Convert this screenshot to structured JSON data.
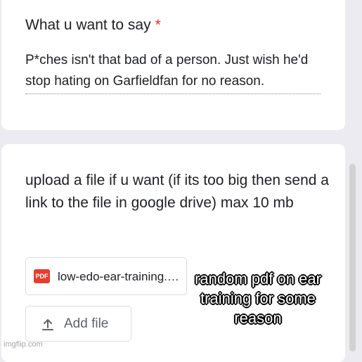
{
  "question_1": {
    "title": "What u want to say",
    "required_mark": "*",
    "answer": "P*ches isn't that bad of a person. Just wish he'd stop hating on Garfieldfan for no reason."
  },
  "question_2": {
    "title": "upload a file if u want (if its too big then send a link to the file in google drive) max 10 mb",
    "file": {
      "type_label": "PDF",
      "name": "low-edo-ear-training.pdf",
      "icon": "pdf-icon"
    },
    "add_file_label": "Add file",
    "add_file_icon": "upload-icon"
  },
  "watermark": "imgflip.com",
  "meme_caption": "random pdf on ear training for some reason",
  "colors": {
    "required": "#d93025",
    "pdf_icon": "#e53d2f",
    "background": "#ecebf2"
  }
}
